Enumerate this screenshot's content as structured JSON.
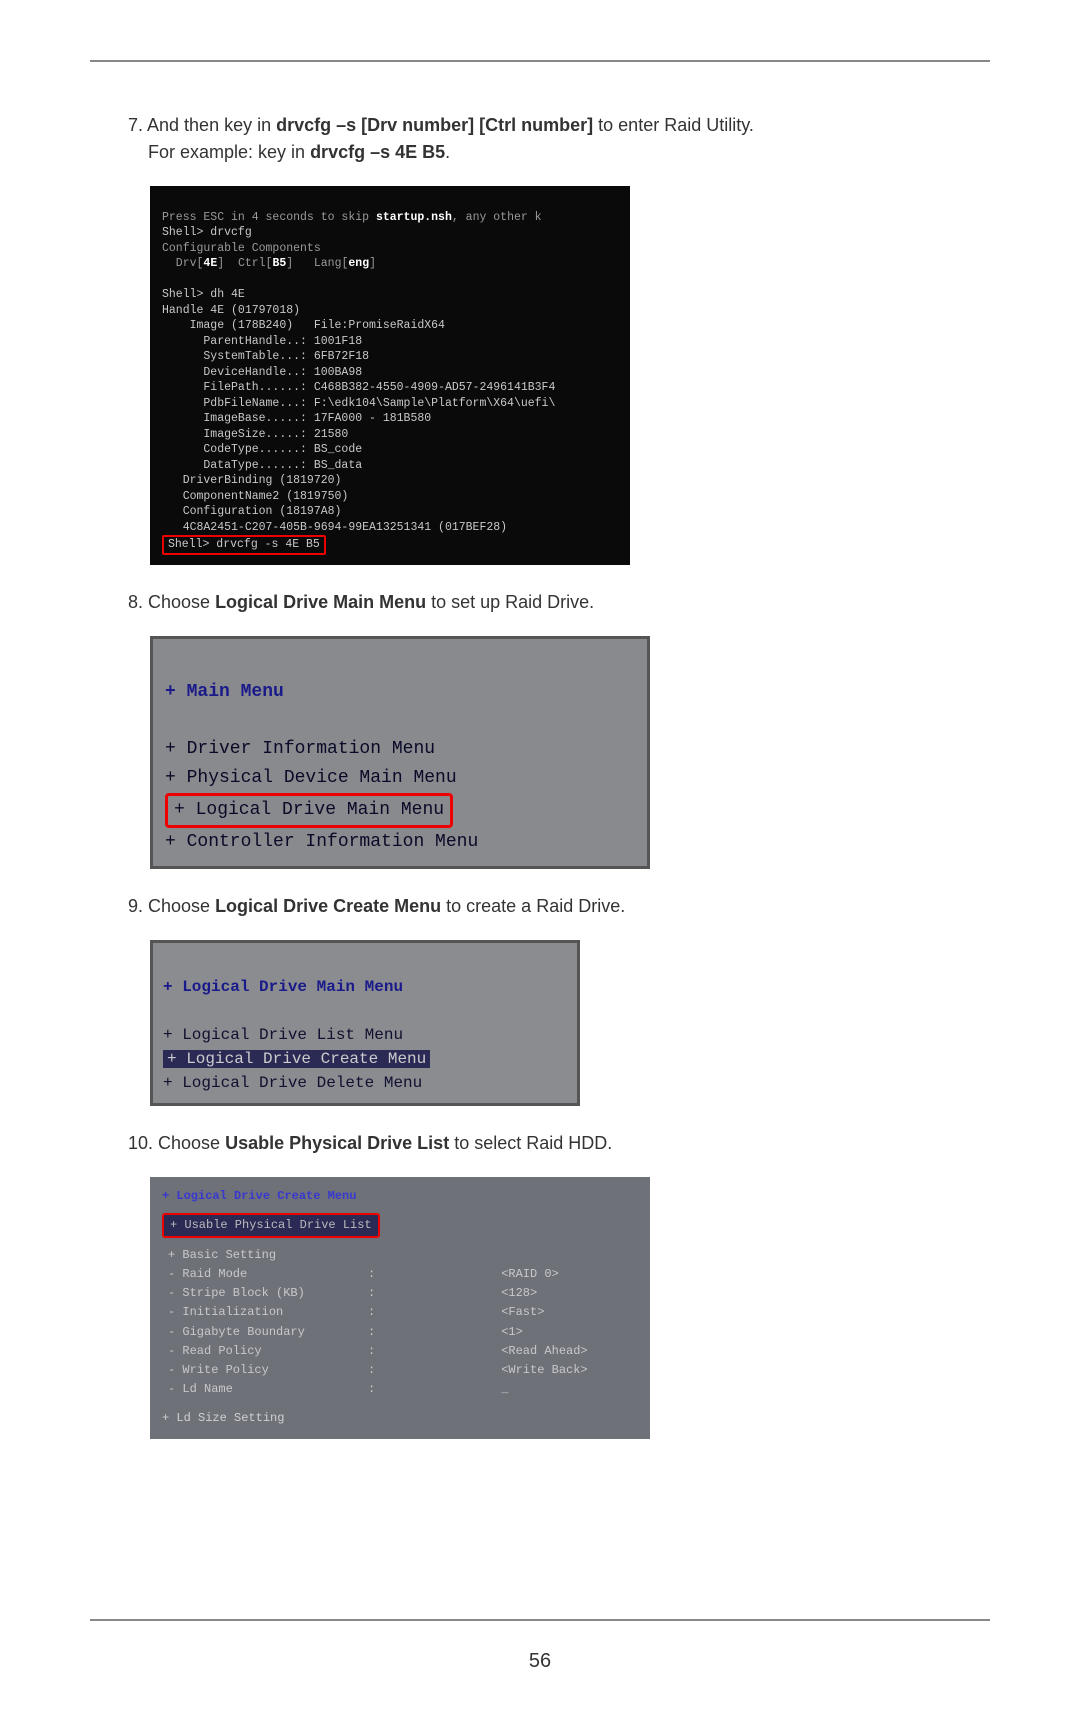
{
  "page_number": "56",
  "steps": {
    "s7": {
      "prefix": "7. And then key in ",
      "bold1": "drvcfg –s [Drv number] [Ctrl number]",
      "mid": " to enter Raid Utility.",
      "line2a": "For example: key in ",
      "bold2": "drvcfg –s 4E B5",
      "line2b": "."
    },
    "s8": {
      "prefix": "8. Choose ",
      "bold": "Logical Drive Main Menu",
      "suffix": " to set up Raid Drive."
    },
    "s9": {
      "prefix": "9. Choose ",
      "bold": "Logical Drive Create Menu",
      "suffix": " to create a Raid Drive."
    },
    "s10": {
      "prefix": "10. Choose ",
      "bold": "Usable Physical Drive List",
      "suffix": " to select Raid HDD."
    }
  },
  "shell": {
    "l0a": "Press ESC in 4 seconds to skip ",
    "l0b": "startup.nsh",
    "l0c": ", any other k",
    "l1": "Shell> drvcfg",
    "l2": "Configurable Components",
    "l3a": "  Drv[",
    "l3b": "4E",
    "l3c": "]  Ctrl[",
    "l3d": "B5",
    "l3e": "]   Lang[",
    "l3f": "eng",
    "l3g": "]",
    "l4": "Shell> dh 4E",
    "l5": "Handle 4E (01797018)",
    "l6": "    Image (178B240)   File:PromiseRaidX64",
    "l7": "      ParentHandle..: 1001F18",
    "l8": "      SystemTable...: 6FB72F18",
    "l9": "      DeviceHandle..: 100BA98",
    "l10": "      FilePath......: C468B382-4550-4909-AD57-2496141B3F4",
    "l11": "      PdbFileName...: F:\\edk104\\Sample\\Platform\\X64\\uefi\\",
    "l12": "      ImageBase.....: 17FA000 - 181B580",
    "l13": "      ImageSize.....: 21580",
    "l14": "      CodeType......: BS_code",
    "l15": "      DataType......: BS_data",
    "l16": "   DriverBinding (1819720)",
    "l17": "   ComponentName2 (1819750)",
    "l18": "   Configuration (18197A8)",
    "l19": "   4C8A2451-C207-405B-9694-99EA13251341 (017BEF28)",
    "l20": "Shell> drvcfg -s 4E B5"
  },
  "menu1": {
    "title": "+ Main Menu",
    "i1": "+ Driver Information Menu",
    "i2": "+ Physical Device Main Menu",
    "i3": "+ Logical Drive Main Menu",
    "i4": "+ Controller Information Menu"
  },
  "menu2": {
    "title": "+ Logical Drive Main Menu",
    "i1": "+ Logical Drive List Menu",
    "i2": "+ Logical Drive Create Menu",
    "i3": "+ Logical Drive Delete Menu"
  },
  "create": {
    "title": "+ Logical Drive Create Menu",
    "highlight": "+ Usable Physical Drive List",
    "rows": [
      {
        "label": "+ Basic Setting",
        "sep": "",
        "val": ""
      },
      {
        "label": "- Raid Mode",
        "sep": ":",
        "val": "<RAID 0>"
      },
      {
        "label": "- Stripe Block (KB)",
        "sep": ":",
        "val": "<128>"
      },
      {
        "label": "- Initialization",
        "sep": ":",
        "val": "<Fast>"
      },
      {
        "label": "- Gigabyte Boundary",
        "sep": ":",
        "val": "<1>"
      },
      {
        "label": "- Read Policy",
        "sep": ":",
        "val": "<Read Ahead>"
      },
      {
        "label": "- Write Policy",
        "sep": ":",
        "val": "<Write Back>"
      },
      {
        "label": "- Ld Name",
        "sep": ":",
        "val": "_"
      }
    ],
    "footer": "+ Ld Size Setting"
  }
}
